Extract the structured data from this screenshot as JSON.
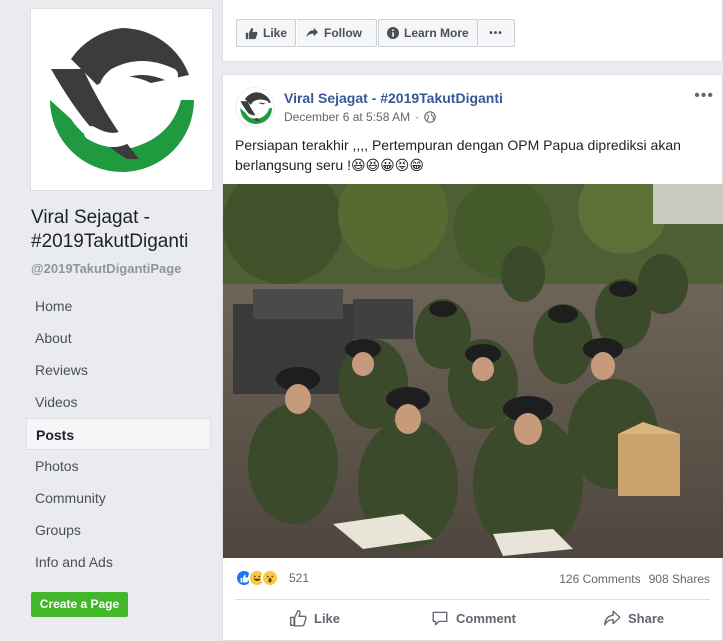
{
  "page": {
    "name": "Viral Sejagat - #2019TakutDiganti",
    "handle": "@2019TakutDigantiPage"
  },
  "nav": [
    {
      "label": "Home"
    },
    {
      "label": "About"
    },
    {
      "label": "Reviews"
    },
    {
      "label": "Videos"
    },
    {
      "label": "Posts",
      "active": true
    },
    {
      "label": "Photos"
    },
    {
      "label": "Community"
    },
    {
      "label": "Groups"
    },
    {
      "label": "Info and Ads"
    }
  ],
  "create_page_label": "Create a Page",
  "action_bar": {
    "like_label": "Like",
    "follow_label": "Follow",
    "learn_more_label": "Learn More",
    "more_label": "•••"
  },
  "post": {
    "author": "Viral Sejagat - #2019TakutDiganti",
    "timestamp": "December 6 at 5:58 AM",
    "text": "Persiapan terakhir ,,,, Pertempuran dengan OPM Papua diprediksi akan berlangsung seru !😆😆😀😝😁",
    "more": "•••",
    "reaction_count": "521",
    "comments": "126 Comments",
    "shares": "908 Shares",
    "like_label": "Like",
    "comment_label": "Comment",
    "share_label": "Share"
  },
  "colors": {
    "brand_link": "#365899",
    "create_green": "#42b72a",
    "logo_dark": "#3c3c3c",
    "logo_green": "#1f9a3e"
  }
}
